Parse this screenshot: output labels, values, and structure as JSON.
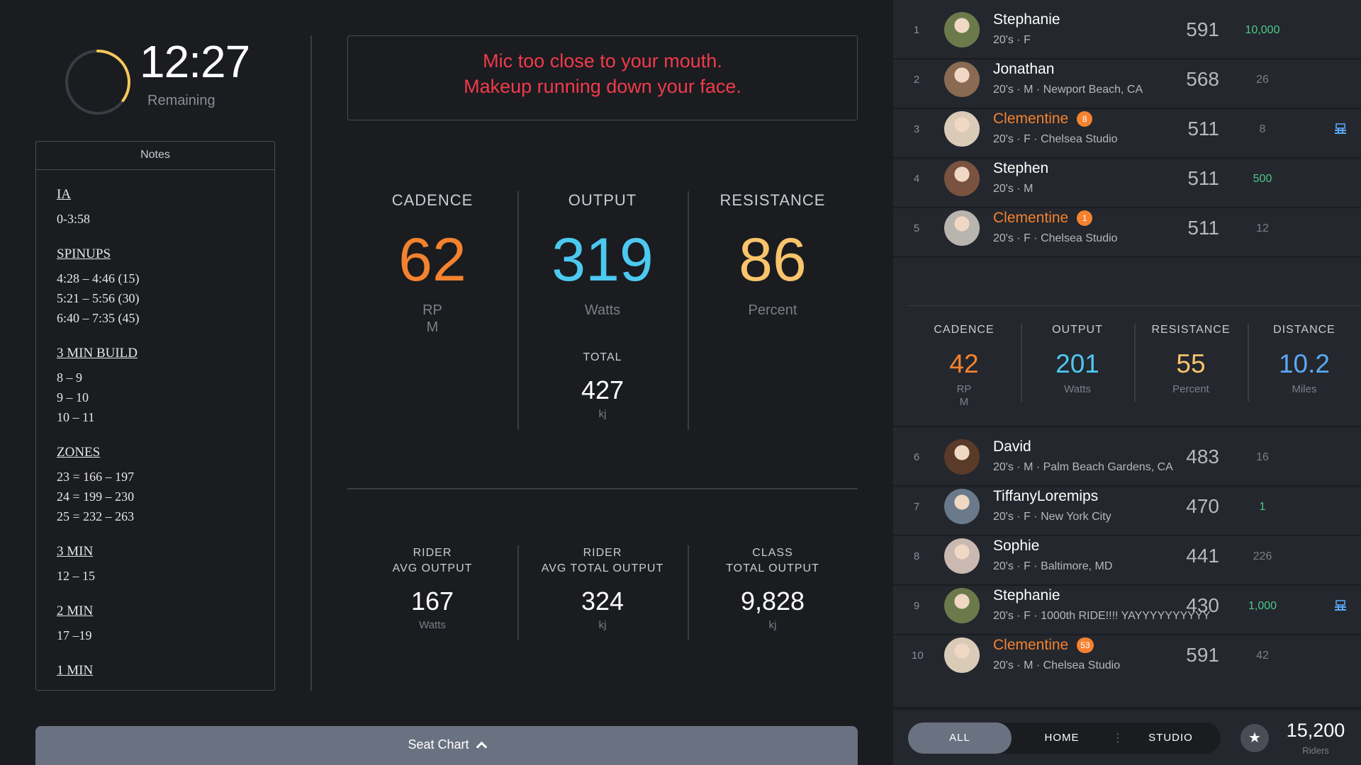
{
  "timer": {
    "time": "12:27",
    "label": "Remaining",
    "progress": 0.35,
    "ring_color": "#f5c85a"
  },
  "notes": {
    "header": "Notes",
    "blocks": [
      {
        "title": "IA",
        "lines": [
          "0-3:58"
        ]
      },
      {
        "title": "SPINUPS",
        "lines": [
          "4:28 – 4:46 (15)",
          "5:21 – 5:56 (30)",
          "6:40 – 7:35 (45)"
        ]
      },
      {
        "title": "3 MIN BUILD",
        "lines": [
          "8 – 9",
          "9 – 10",
          "10 – 11"
        ]
      },
      {
        "title": "ZONES",
        "lines": [
          "23 = 166 – 197",
          "24 = 199 – 230",
          "25 = 232 – 263"
        ]
      },
      {
        "title": "3 MIN",
        "lines": [
          "12 – 15"
        ]
      },
      {
        "title": "2 MIN",
        "lines": [
          "17 –19"
        ]
      },
      {
        "title": "1 MIN",
        "lines": []
      }
    ]
  },
  "alert": {
    "line1": "Mic too close to your mouth.",
    "line2": "Makeup running down your face."
  },
  "metrics": {
    "cadence": {
      "label": "CADENCE",
      "value": "62",
      "unit_line1": "RP",
      "unit_line2": "M",
      "color": "#f4822f"
    },
    "output": {
      "label": "OUTPUT",
      "value": "319",
      "unit": "Watts",
      "color": "#4cc9f0",
      "total_label": "TOTAL",
      "total_value": "427",
      "total_unit": "kj"
    },
    "resistance": {
      "label": "RESISTANCE",
      "value": "86",
      "unit": "Percent",
      "color": "#f9c46b"
    }
  },
  "stats": [
    {
      "label_line1": "RIDER",
      "label_line2": "AVG OUTPUT",
      "value": "167",
      "unit": "Watts"
    },
    {
      "label_line1": "RIDER",
      "label_line2": "AVG TOTAL OUTPUT",
      "value": "324",
      "unit": "kj"
    },
    {
      "label_line1": "CLASS",
      "label_line2": "TOTAL OUTPUT",
      "value": "9,828",
      "unit": "kj"
    }
  ],
  "seat_chart": {
    "label": "Seat Chart"
  },
  "leaderboard": {
    "rows": [
      {
        "rank": "1",
        "name": "Stephanie",
        "meta": "20's  ·  F",
        "score": "591",
        "diff": "10,000",
        "diff_green": true,
        "highlight": false,
        "badge": "",
        "bike": false,
        "avatar_color": "#6b7a4a"
      },
      {
        "rank": "2",
        "name": "Jonathan",
        "meta": "20's  ·  M  ·  Newport Beach, CA",
        "score": "568",
        "diff": "26",
        "diff_green": false,
        "highlight": false,
        "badge": "",
        "bike": false,
        "avatar_color": "#8a6a52"
      },
      {
        "rank": "3",
        "name": "Clementine",
        "meta": "20's  ·  F  ·  Chelsea Studio",
        "score": "511",
        "diff": "8",
        "diff_green": false,
        "highlight": true,
        "badge": "8",
        "bike": true,
        "avatar_color": "#d9cbb8"
      },
      {
        "rank": "4",
        "name": "Stephen",
        "meta": "20's  ·  M",
        "score": "511",
        "diff": "500",
        "diff_green": true,
        "highlight": false,
        "badge": "",
        "bike": false,
        "avatar_color": "#7a5240"
      },
      {
        "rank": "5",
        "name": "Clementine",
        "meta": "20's  ·  F  ·  Chelsea Studio",
        "score": "511",
        "diff": "12",
        "diff_green": false,
        "highlight": true,
        "badge": "1",
        "bike": false,
        "avatar_color": "#b8b4ae"
      },
      {
        "rank": "6",
        "name": "David",
        "meta": "20's  ·  M  ·  Palm Beach Gardens, CA",
        "score": "483",
        "diff": "16",
        "diff_green": false,
        "highlight": false,
        "badge": "",
        "bike": false,
        "avatar_color": "#5a3a28"
      },
      {
        "rank": "7",
        "name": "TiffanyLoremips",
        "meta": "20's  ·  F  ·  New York City",
        "score": "470",
        "diff": "1",
        "diff_green": true,
        "highlight": false,
        "badge": "",
        "bike": false,
        "avatar_color": "#6a7a8a"
      },
      {
        "rank": "8",
        "name": "Sophie",
        "meta": "20's  ·  F  ·  Baltimore, MD",
        "score": "441",
        "diff": "226",
        "diff_green": false,
        "highlight": false,
        "badge": "",
        "bike": false,
        "avatar_color": "#c9b9b0"
      },
      {
        "rank": "9",
        "name": "Stephanie",
        "meta": "20's  ·  F  ·  1000th RIDE!!!! YAYYYYYYYYYY",
        "score": "430",
        "diff": "1,000",
        "diff_green": true,
        "highlight": false,
        "badge": "",
        "bike": true,
        "avatar_color": "#6b7a4a"
      },
      {
        "rank": "10",
        "name": "Clementine",
        "meta": "20's  ·  M  ·  Chelsea Studio",
        "score": "591",
        "diff": "42",
        "diff_green": false,
        "highlight": true,
        "badge": "53",
        "bike": false,
        "avatar_color": "#d9cbb8"
      }
    ],
    "self_metrics": [
      {
        "label": "CADENCE",
        "value": "42",
        "unit_line1": "RP",
        "unit_line2": "M",
        "color": "#f4822f"
      },
      {
        "label": "OUTPUT",
        "value": "201",
        "unit_line1": "Watts",
        "unit_line2": "",
        "color": "#4cc9f0"
      },
      {
        "label": "RESISTANCE",
        "value": "55",
        "unit_line1": "Percent",
        "unit_line2": "",
        "color": "#f9c46b"
      },
      {
        "label": "DISTANCE",
        "value": "10.2",
        "unit_line1": "Miles",
        "unit_line2": "",
        "color": "#5aa8f5"
      }
    ]
  },
  "footer": {
    "filters": [
      "ALL",
      "HOME",
      "STUDIO"
    ],
    "separator": "⋮",
    "active_filter": "ALL",
    "star_icon": "★",
    "riders_count": "15,200",
    "riders_label": "Riders"
  }
}
